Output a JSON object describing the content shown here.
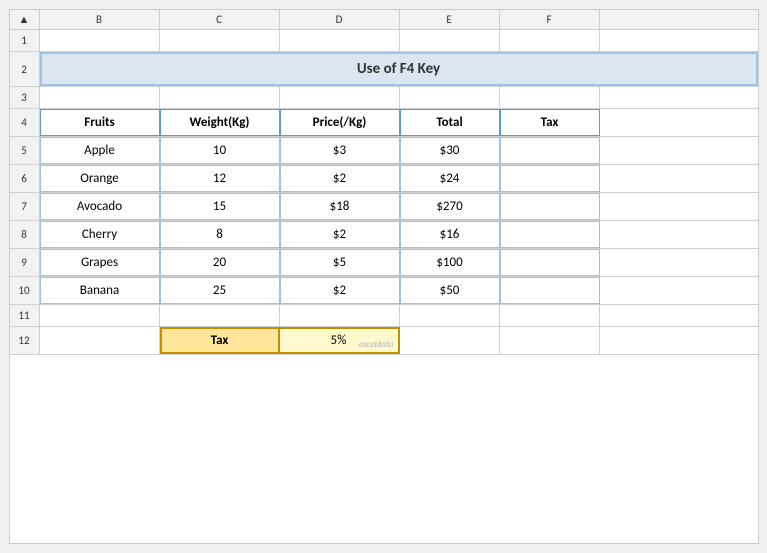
{
  "title": "Use of F4 Key",
  "columns": {
    "a": "",
    "b": "B",
    "c": "C",
    "d": "D",
    "e": "E",
    "f": "F"
  },
  "rows": {
    "row1": "1",
    "row2": "2",
    "row3": "3",
    "row4": "4",
    "row5": "5",
    "row6": "6",
    "row7": "7",
    "row8": "8",
    "row9": "9",
    "row10": "10",
    "row11": "11",
    "row12": "12"
  },
  "table": {
    "headers": [
      "Fruits",
      "Weight(Kg)",
      "Price(/Kg)",
      "Total",
      "Tax"
    ],
    "rows": [
      [
        "Apple",
        "10",
        "$3",
        "$30",
        ""
      ],
      [
        "Orange",
        "12",
        "$2",
        "$24",
        ""
      ],
      [
        "Avocado",
        "15",
        "$18",
        "$270",
        ""
      ],
      [
        "Cherry",
        "8",
        "$2",
        "$16",
        ""
      ],
      [
        "Grapes",
        "20",
        "$5",
        "$100",
        ""
      ],
      [
        "Banana",
        "25",
        "$2",
        "$50",
        ""
      ]
    ]
  },
  "tax": {
    "label": "Tax",
    "value": "5%"
  }
}
